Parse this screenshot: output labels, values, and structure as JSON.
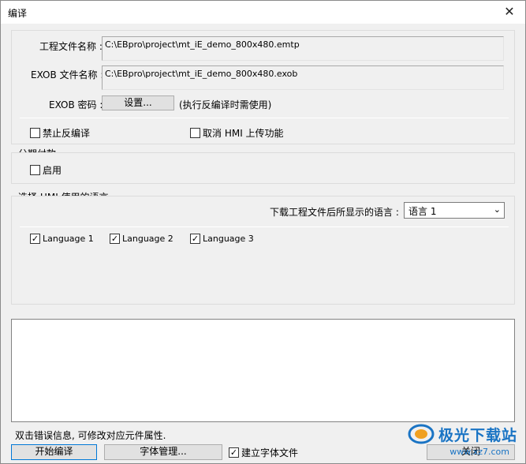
{
  "window": {
    "title": "编译",
    "close_glyph": "✕"
  },
  "fields": {
    "project_label": "工程文件名称 :",
    "project_value": "C:\\EBpro\\project\\mt_iE_demo_800x480.emtp",
    "exob_label": "EXOB 文件名称 :",
    "exob_value": "C:\\EBpro\\project\\mt_iE_demo_800x480.exob",
    "password_label": "EXOB 密码 :",
    "settings_button": "设置...",
    "password_hint": "(执行反编译时需使用)"
  },
  "options": {
    "forbid_decompile": {
      "label": "禁止反编译",
      "checked": false
    },
    "cancel_upload": {
      "label": "取消 HMI 上传功能",
      "checked": false
    }
  },
  "installment": {
    "title": "分期付款",
    "enable": {
      "label": "启用",
      "checked": false
    }
  },
  "language": {
    "title": "选择 HMI 使用的语言",
    "display_label": "下载工程文件后所显示的语言 :",
    "display_value": "语言 1",
    "languages": [
      {
        "label": "Language 1",
        "checked": true
      },
      {
        "label": "Language 2",
        "checked": true
      },
      {
        "label": "Language 3",
        "checked": true
      }
    ]
  },
  "footer": {
    "hint": "双击错误信息, 可修改对应元件属性.",
    "compile_button": "开始编译",
    "font_button": "字体管理...",
    "font_file": {
      "label": "建立字体文件",
      "checked": true
    },
    "close_button": "关闭"
  },
  "watermark": {
    "text": "极光下载站",
    "url": "www.xz7.com",
    "color": "#1a74c4"
  },
  "check_glyph": "✓"
}
